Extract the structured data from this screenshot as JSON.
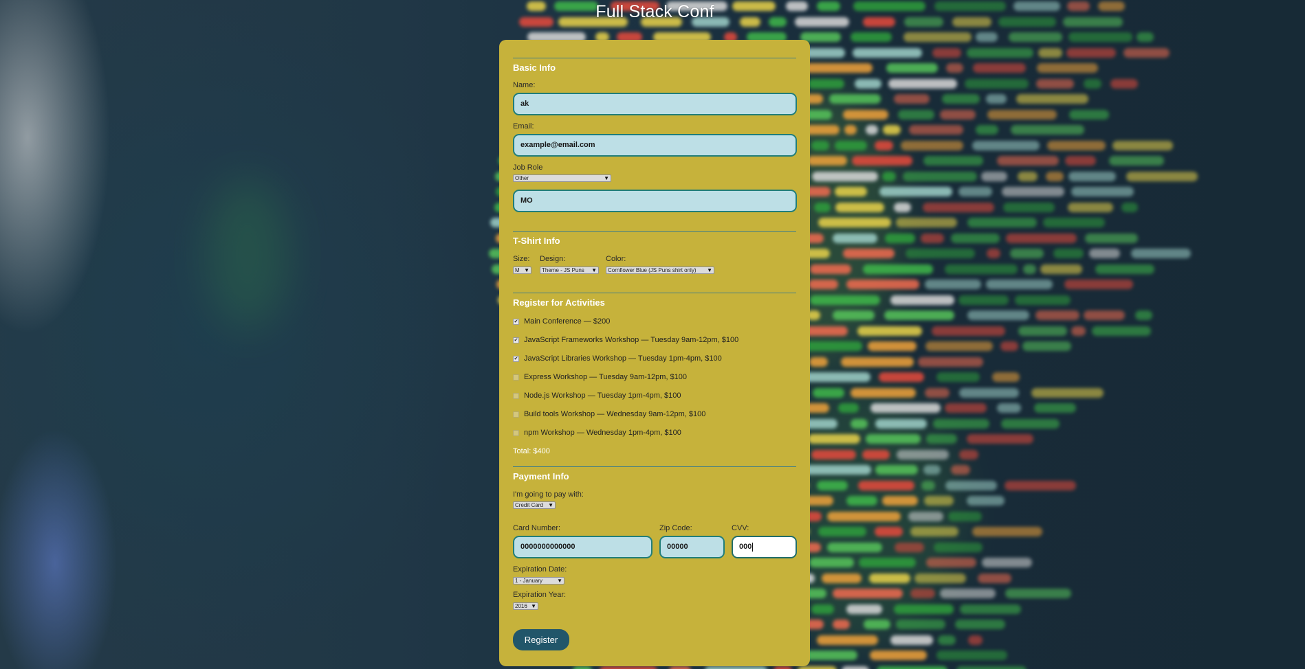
{
  "title": "Full Stack Conf",
  "basic_info": {
    "legend": "Basic Info",
    "name_label": "Name:",
    "name_value": "ak",
    "email_label": "Email:",
    "email_value": "example@email.com",
    "job_role_label": "Job Role",
    "job_role_selected": "Other",
    "other_title_value": "MO"
  },
  "tshirt_info": {
    "legend": "T-Shirt Info",
    "size_label": "Size:",
    "size_selected": "M",
    "design_label": "Design:",
    "design_selected": "Theme - JS Puns",
    "color_label": "Color:",
    "color_selected": "Cornflower Blue (JS Puns shirt only)"
  },
  "activities": {
    "legend": "Register for Activities",
    "items": [
      {
        "label": "Main Conference — $200",
        "checked": true
      },
      {
        "label": "JavaScript Frameworks Workshop — Tuesday 9am-12pm, $100",
        "checked": true
      },
      {
        "label": "JavaScript Libraries Workshop — Tuesday 1pm-4pm, $100",
        "checked": true
      },
      {
        "label": "Express Workshop — Tuesday 9am-12pm, $100",
        "checked": false
      },
      {
        "label": "Node.js Workshop — Tuesday 1pm-4pm, $100",
        "checked": false
      },
      {
        "label": "Build tools Workshop — Wednesday 9am-12pm, $100",
        "checked": false
      },
      {
        "label": "npm Workshop — Wednesday 1pm-4pm, $100",
        "checked": false
      }
    ],
    "total": "Total: $400"
  },
  "payment_info": {
    "legend": "Payment Info",
    "pay_with_label": "I'm going to pay with:",
    "pay_with_selected": "Credit Card",
    "card_number_label": "Card Number:",
    "card_number_value": "0000000000000",
    "zip_label": "Zip Code:",
    "zip_value": "00000",
    "cvv_label": "CVV:",
    "cvv_value": "000",
    "exp_date_label": "Expiration Date:",
    "exp_date_selected": "1 - January",
    "exp_year_label": "Expiration Year:",
    "exp_year_selected": "2016"
  },
  "register_label": "Register",
  "colors": {
    "panel": "#c6b23b",
    "input_bg": "#bddfe6",
    "input_border": "#217e7a",
    "button": "#21566a"
  }
}
